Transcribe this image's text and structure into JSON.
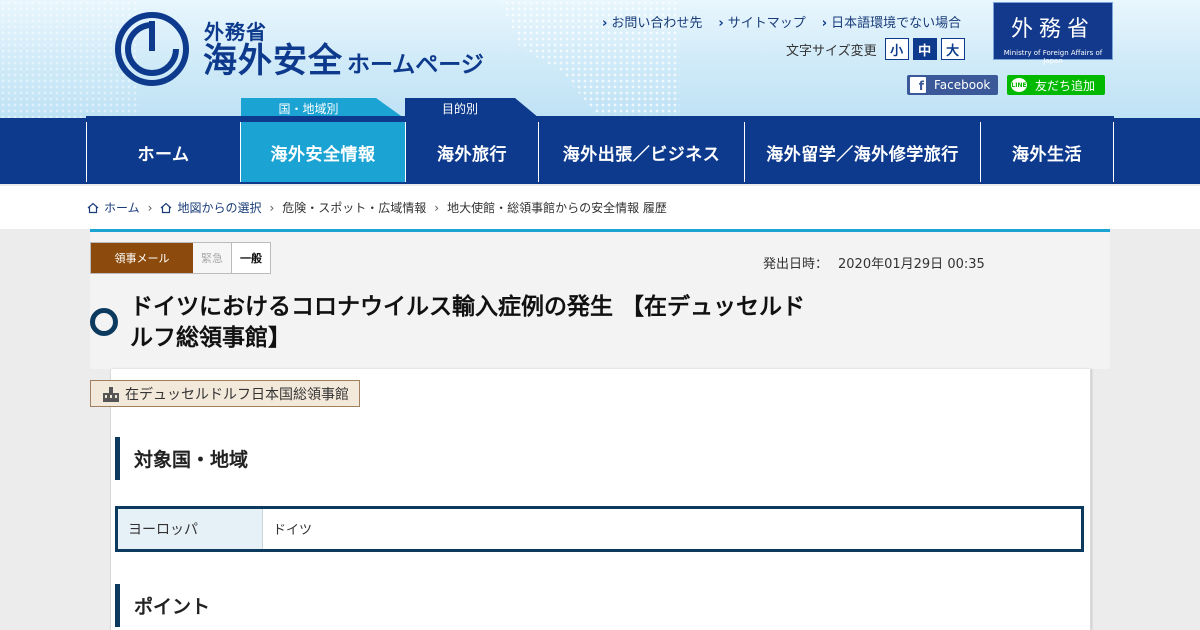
{
  "header": {
    "site_sub": "外務省",
    "site_main": "海外安全",
    "site_main_small": "ホームページ",
    "util_links": [
      "お問い合わせ先",
      "サイトマップ",
      "日本語環境でない場合"
    ],
    "font_size_label": "文字サイズ変更",
    "font_sizes": [
      "小",
      "中",
      "大"
    ],
    "mofa_kanji": "外務省",
    "mofa_eng": "Ministry of Foreign Affairs of Japan",
    "facebook_label": "Facebook",
    "line_icon": "LINE",
    "line_label": "友だち追加",
    "tab_country": "国・地域別",
    "tab_purpose": "目的別"
  },
  "nav": {
    "items": [
      "ホーム",
      "海外安全情報",
      "海外旅行",
      "海外出張／ビジネス",
      "海外留学／海外修学旅行",
      "海外生活"
    ],
    "active_index": 1
  },
  "breadcrumb": {
    "items": [
      "ホーム",
      "地図からの選択",
      "危険・スポット・広域情報",
      "地大使館・総領事館からの安全情報 履歴"
    ]
  },
  "article": {
    "badge_mail": "領事メール",
    "badge_urgent": "緊急",
    "badge_general": "一般",
    "issued_label": "発出日時：",
    "issued_value": "2020年01月29日 00:35",
    "title": "ドイツにおけるコロナウイルス輸入症例の発生 【在デュッセルドルフ総領事館】",
    "source": "在デュッセルドルフ日本国総領事館",
    "section_target": "対象国・地域",
    "region": "ヨーロッパ",
    "country": "ドイツ",
    "section_point": "ポイント"
  },
  "colors": {
    "navy": "#0d3a8c",
    "active_tab": "#1ba3d3",
    "mail_badge": "#8c4b0c",
    "facebook": "#3b5998",
    "line": "#00b900"
  }
}
